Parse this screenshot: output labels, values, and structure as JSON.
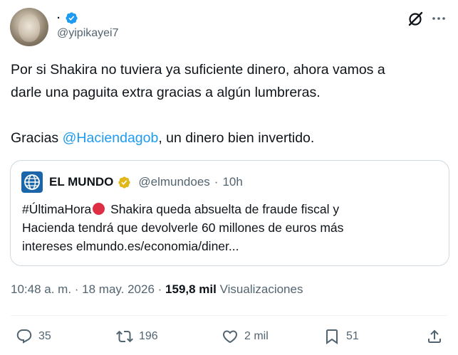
{
  "author": {
    "display_name": "·",
    "handle": "@yipikayei7",
    "verified_color": "#1d9bf0"
  },
  "header_icons": [
    "grok-icon",
    "more-icon"
  ],
  "tweet": {
    "line1": "Por si Shakira no tuviera ya suficiente dinero, ahora vamos a",
    "line2": "darle una paguita extra gracias a algún lumbreras.",
    "line3_prefix": "Gracias ",
    "mention": "@Haciendagob",
    "line3_suffix": ", un dinero bien invertido."
  },
  "quote": {
    "name": "EL MUNDO",
    "handle": "@elmundoes",
    "separator": "·",
    "time": "10h",
    "badge_color": "#e2b719",
    "line1_prefix": "#ÚltimaHora",
    "line1_suffix": " Shakira queda absuelta de fraude fiscal y",
    "line2": "Hacienda tendrá que devolverle 60 millones de euros más",
    "line3": "intereses elmundo.es/economia/diner..."
  },
  "meta": {
    "time": "10:48 a. m.",
    "sep1": " · ",
    "date": "18 may. 2026",
    "sep2": " · ",
    "views_count": "159,8 mil",
    "views_label": " Visualizaciones"
  },
  "actions": {
    "replies": "35",
    "reposts": "196",
    "likes": "2 mil",
    "bookmarks": "51"
  },
  "colors": {
    "link": "#1d9bf0",
    "secondary_text": "#536471",
    "primary_text": "#0f1419",
    "border": "#cfd9de"
  }
}
